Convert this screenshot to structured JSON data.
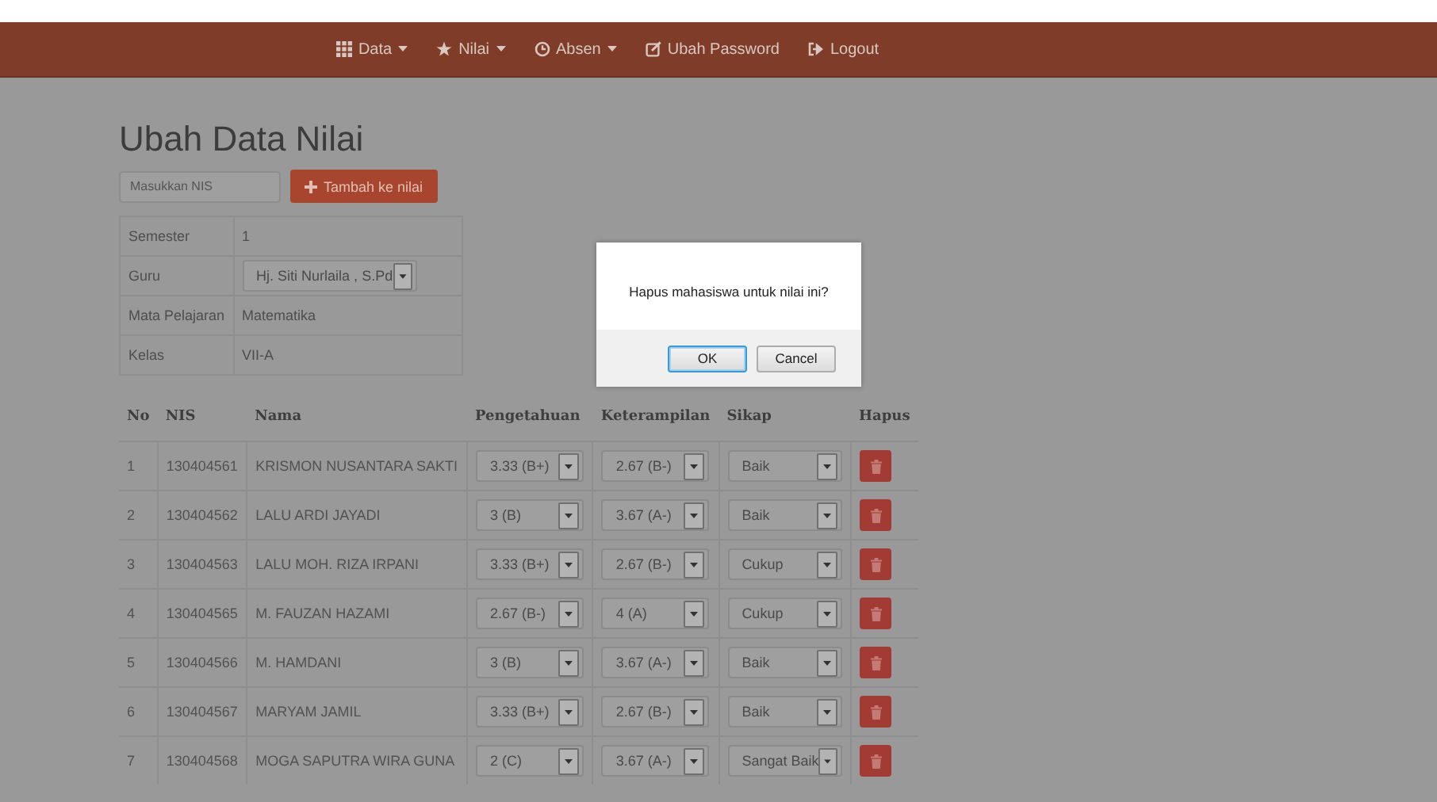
{
  "nav": {
    "items": [
      {
        "label": "Data",
        "dropdown": true
      },
      {
        "label": "Nilai",
        "dropdown": true
      },
      {
        "label": "Absen",
        "dropdown": true
      },
      {
        "label": "Ubah Password",
        "dropdown": false
      },
      {
        "label": "Logout",
        "dropdown": false
      }
    ]
  },
  "page_title": "Ubah Data Nilai",
  "nis_field": {
    "placeholder": "Masukkan NIS"
  },
  "add_button": {
    "label": "Tambah ke nilai"
  },
  "info": [
    {
      "label": "Semester",
      "value": "1",
      "kind": "text"
    },
    {
      "label": "Guru",
      "value": "Hj. Siti Nurlaila , S.Pd",
      "kind": "select"
    },
    {
      "label": "Mata Pelajaran",
      "value": "Matematika",
      "kind": "text"
    },
    {
      "label": "Kelas",
      "value": "VII-A",
      "kind": "text"
    }
  ],
  "table": {
    "columns": [
      "No",
      "NIS",
      "Nama",
      "Pengetahuan",
      "Keterampilan",
      "Sikap",
      "Hapus"
    ],
    "rows": [
      {
        "no": "1",
        "nis": "130404561",
        "nama": "KRISMON NUSANTARA SAKTI",
        "pengetahuan": "3.33 (B+)",
        "keterampilan": "2.67 (B-)",
        "sikap": "Baik"
      },
      {
        "no": "2",
        "nis": "130404562",
        "nama": "LALU ARDI JAYADI",
        "pengetahuan": "3 (B)",
        "keterampilan": "3.67 (A-)",
        "sikap": "Baik"
      },
      {
        "no": "3",
        "nis": "130404563",
        "nama": "LALU MOH. RIZA IRPANI",
        "pengetahuan": "3.33 (B+)",
        "keterampilan": "2.67 (B-)",
        "sikap": "Cukup"
      },
      {
        "no": "4",
        "nis": "130404565",
        "nama": "M. FAUZAN HAZAMI",
        "pengetahuan": "2.67 (B-)",
        "keterampilan": "4 (A)",
        "sikap": "Cukup"
      },
      {
        "no": "5",
        "nis": "130404566",
        "nama": "M. HAMDANI",
        "pengetahuan": "3 (B)",
        "keterampilan": "3.67 (A-)",
        "sikap": "Baik"
      },
      {
        "no": "6",
        "nis": "130404567",
        "nama": "MARYAM JAMIL",
        "pengetahuan": "3.33 (B+)",
        "keterampilan": "2.67 (B-)",
        "sikap": "Baik"
      },
      {
        "no": "7",
        "nis": "130404568",
        "nama": "MOGA SAPUTRA WIRA GUNA",
        "pengetahuan": "2 (C)",
        "keterampilan": "3.67 (A-)",
        "sikap": "Sangat Baik"
      }
    ]
  },
  "dialog": {
    "message": "Hapus mahasiswa untuk nilai ini?",
    "buttons": [
      {
        "label": "OK",
        "focused": true
      },
      {
        "label": "Cancel",
        "focused": false
      }
    ]
  }
}
